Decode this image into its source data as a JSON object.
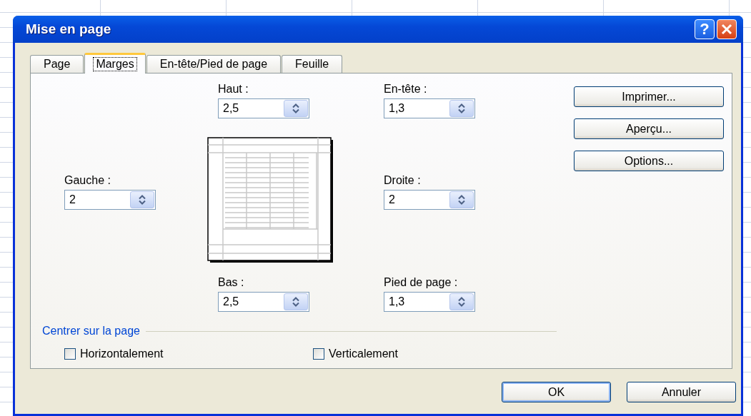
{
  "window": {
    "title": "Mise en page"
  },
  "title_buttons": [
    {
      "kind": "help",
      "label": "?"
    },
    {
      "kind": "close"
    }
  ],
  "tabs": [
    {
      "label": "Page",
      "selected": false
    },
    {
      "label": "Marges",
      "selected": true
    },
    {
      "label": "En-tête/Pied de page",
      "selected": false
    },
    {
      "label": "Feuille",
      "selected": false
    }
  ],
  "fields": [
    {
      "kind": "top",
      "label": "Haut :",
      "value": "2,5"
    },
    {
      "kind": "header",
      "label": "En-tête :",
      "value": "1,3"
    },
    {
      "kind": "left",
      "label": "Gauche :",
      "value": "2"
    },
    {
      "kind": "right",
      "label": "Droite :",
      "value": "2"
    },
    {
      "kind": "bottom",
      "label": "Bas :",
      "value": "2,5"
    },
    {
      "kind": "footer",
      "label": "Pied de page :",
      "value": "1,3"
    }
  ],
  "side_buttons": [
    "Imprimer...",
    "Aperçu...",
    "Options..."
  ],
  "center_group": {
    "title": "Centrer sur la page",
    "options": [
      {
        "label": "Horizontalement",
        "checked": false
      },
      {
        "label": "Verticalement",
        "checked": false
      }
    ]
  },
  "buttons": [
    {
      "label": "OK",
      "default": true
    },
    {
      "label": "Annuler",
      "default": false
    }
  ]
}
